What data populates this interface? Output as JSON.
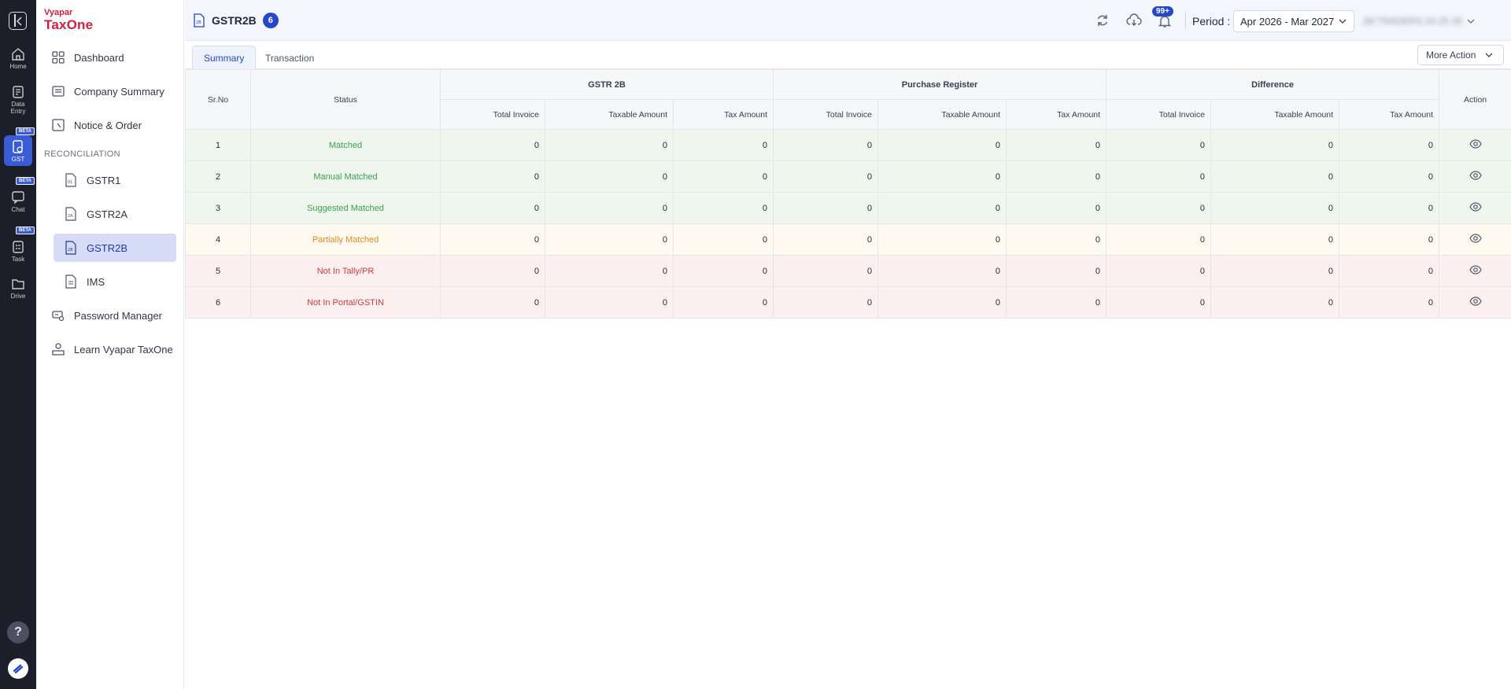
{
  "rail": {
    "items": [
      {
        "label": "Home"
      },
      {
        "label": "Data Entry"
      },
      {
        "label": "GST",
        "beta": "BETA"
      },
      {
        "label": "Chat",
        "beta": "BETA"
      },
      {
        "label": "Task",
        "beta": "BETA"
      },
      {
        "label": "Drive"
      }
    ],
    "help": "?"
  },
  "brand": {
    "line1": "Vyapar",
    "line2": "TaxOne"
  },
  "sidebar": {
    "dashboard": "Dashboard",
    "company_summary": "Company Summary",
    "notice_order": "Notice & Order",
    "section": "RECONCILIATION",
    "gstr1": "GSTR1",
    "gstr2a": "GSTR2A",
    "gstr2b": "GSTR2B",
    "ims": "IMS",
    "password_manager": "Password Manager",
    "learn": "Learn Vyapar TaxOne"
  },
  "header": {
    "title": "GSTR2B",
    "count": "6",
    "notifications": "99+",
    "period_label": "Period :",
    "period_value": "Apr 2026 - Mar 2027",
    "company": "JM TRADERS 24 25 26"
  },
  "tabs": {
    "summary": "Summary",
    "transaction": "Transaction",
    "more_action": "More Action"
  },
  "table": {
    "groups": {
      "srno": "Sr.No",
      "status": "Status",
      "g1": "GSTR 2B",
      "g2": "Purchase Register",
      "g3": "Difference",
      "action": "Action"
    },
    "sub": {
      "total_invoice": "Total Invoice",
      "taxable_amount": "Taxable Amount",
      "tax_amount": "Tax Amount"
    },
    "rows": [
      {
        "sr": "1",
        "status": "Matched",
        "v": [
          "0",
          "0",
          "0",
          "0",
          "0",
          "0",
          "0",
          "0",
          "0"
        ]
      },
      {
        "sr": "2",
        "status": "Manual Matched",
        "v": [
          "0",
          "0",
          "0",
          "0",
          "0",
          "0",
          "0",
          "0",
          "0"
        ]
      },
      {
        "sr": "3",
        "status": "Suggested Matched",
        "v": [
          "0",
          "0",
          "0",
          "0",
          "0",
          "0",
          "0",
          "0",
          "0"
        ]
      },
      {
        "sr": "4",
        "status": "Partially Matched",
        "v": [
          "0",
          "0",
          "0",
          "0",
          "0",
          "0",
          "0",
          "0",
          "0"
        ]
      },
      {
        "sr": "5",
        "status": "Not In Tally/PR",
        "v": [
          "0",
          "0",
          "0",
          "0",
          "0",
          "0",
          "0",
          "0",
          "0"
        ]
      },
      {
        "sr": "6",
        "status": "Not In Portal/GSTIN",
        "v": [
          "0",
          "0",
          "0",
          "0",
          "0",
          "0",
          "0",
          "0",
          "0"
        ]
      }
    ]
  },
  "colors": {
    "accent": "#2648c8",
    "matched": "#3aa14a",
    "partial": "#dc8b24",
    "missing": "#d33a3a",
    "brand": "#d21f3c"
  }
}
